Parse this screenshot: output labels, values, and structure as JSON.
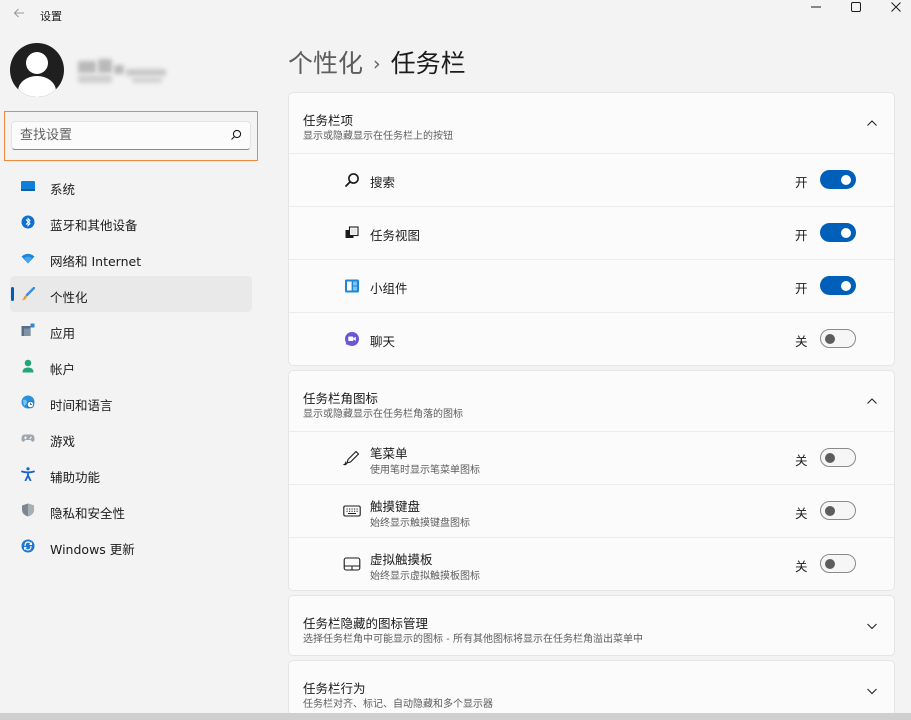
{
  "window": {
    "title": "设置",
    "back_icon": "back-arrow-icon",
    "min_icon": "minimize-icon",
    "max_icon": "maximize-icon",
    "close_icon": "close-icon"
  },
  "profile": {
    "avatar": "default-user-avatar"
  },
  "search": {
    "placeholder": "查找设置",
    "icon": "search-icon"
  },
  "sidebar": {
    "selected_index": 3,
    "accent": "#005fb8",
    "items": [
      {
        "label": "系统",
        "icon": "system-icon"
      },
      {
        "label": "蓝牙和其他设备",
        "icon": "bluetooth-icon"
      },
      {
        "label": "网络和 Internet",
        "icon": "wifi-icon"
      },
      {
        "label": "个性化",
        "icon": "brush-icon"
      },
      {
        "label": "应用",
        "icon": "apps-icon"
      },
      {
        "label": "帐户",
        "icon": "account-icon"
      },
      {
        "label": "时间和语言",
        "icon": "globe-clock-icon"
      },
      {
        "label": "游戏",
        "icon": "gamepad-icon"
      },
      {
        "label": "辅助功能",
        "icon": "accessibility-icon"
      },
      {
        "label": "隐私和安全性",
        "icon": "shield-icon"
      },
      {
        "label": "Windows 更新",
        "icon": "windows-update-icon"
      }
    ]
  },
  "breadcrumb": {
    "parent": "个性化",
    "separator": "›",
    "current": "任务栏"
  },
  "sections": {
    "taskbar_items": {
      "title": "任务栏项",
      "desc": "显示或隐藏显示在任务栏上的按钮",
      "expanded": true,
      "rows": [
        {
          "label": "搜索",
          "icon": "search-icon",
          "state": "开",
          "on": true
        },
        {
          "label": "任务视图",
          "icon": "task-view-icon",
          "state": "开",
          "on": true
        },
        {
          "label": "小组件",
          "icon": "widgets-icon",
          "state": "开",
          "on": true
        },
        {
          "label": "聊天",
          "icon": "chat-icon",
          "state": "关",
          "on": false
        }
      ]
    },
    "corner_icons": {
      "title": "任务栏角图标",
      "desc": "显示或隐藏显示在任务栏角落的图标",
      "expanded": true,
      "rows": [
        {
          "label": "笔菜单",
          "sub": "使用笔时显示笔菜单图标",
          "icon": "pen-icon",
          "state": "关",
          "on": false
        },
        {
          "label": "触摸键盘",
          "sub": "始终显示触摸键盘图标",
          "icon": "keyboard-icon",
          "state": "关",
          "on": false
        },
        {
          "label": "虚拟触摸板",
          "sub": "始终显示虚拟触摸板图标",
          "icon": "touchpad-icon",
          "state": "关",
          "on": false
        }
      ]
    },
    "overflow": {
      "title": "任务栏隐藏的图标管理",
      "desc": "选择任务栏角中可能显示的图标 - 所有其他图标将显示在任务栏角溢出菜单中",
      "expanded": false
    },
    "behaviors": {
      "title": "任务栏行为",
      "desc": "任务栏对齐、标记、自动隐藏和多个显示器",
      "expanded": false
    }
  }
}
